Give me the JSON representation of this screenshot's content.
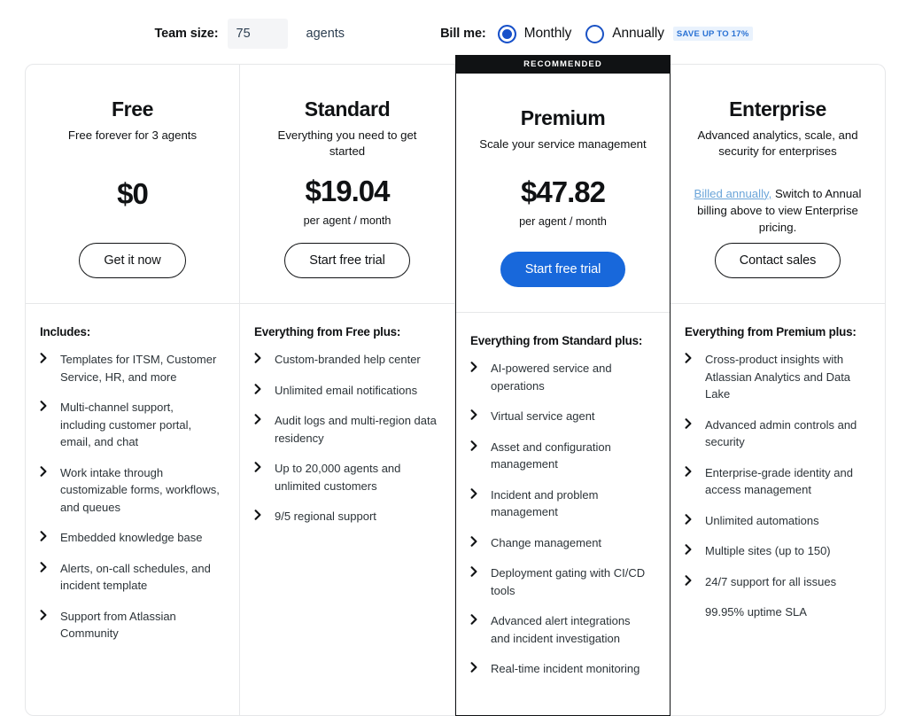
{
  "controls": {
    "team_size_label": "Team size:",
    "team_size_value": "75",
    "team_size_placeholder": "75",
    "agents_unit": "agents",
    "bill_me_label": "Bill me:",
    "billing_options": [
      {
        "label": "Monthly",
        "selected": true
      },
      {
        "label": "Annually",
        "selected": false
      }
    ],
    "monthly_label": "Monthly",
    "annually_label": "Annually",
    "save_badge": "SAVE UP TO 17%"
  },
  "colors": {
    "recommended_banner_bg": "#101214",
    "primary_cta_bg": "#1868db",
    "radio_selected": "#1750c9",
    "save_badge_text": "#2a72d4",
    "save_badge_bg": "#e9f2fd",
    "link_blue": "#6ba5d9",
    "border_grey": "#e6e7e9"
  },
  "plans": [
    {
      "name": "Free",
      "tagline": "Free forever for 3 agents",
      "price": "$0",
      "period": "",
      "cta": "Get it now",
      "cta_style": "outline",
      "recommended": false,
      "features_title": "Includes:",
      "features": [
        "Templates for ITSM, Customer Service, HR, and more",
        "Multi-channel support, including customer portal, email, and chat",
        "Work intake through customizable forms, workflows, and queues",
        "Embedded knowledge base",
        "Alerts, on-call schedules, and incident template",
        "Support from Atlassian Community"
      ]
    },
    {
      "name": "Standard",
      "tagline": "Everything you need to get started",
      "price": "$19.04",
      "period": "per agent / month",
      "cta": "Start free trial",
      "cta_style": "outline",
      "recommended": false,
      "features_title": "Everything from Free plus:",
      "features": [
        "Custom-branded help center",
        "Unlimited email notifications",
        "Audit logs and multi-region data residency",
        "Up to 20,000 agents and unlimited customers",
        "9/5 regional support"
      ]
    },
    {
      "name": "Premium",
      "tagline": "Scale your service management",
      "price": "$47.82",
      "period": "per agent / month",
      "cta": "Start free trial",
      "cta_style": "primary",
      "recommended": true,
      "recommended_badge": "RECOMMENDED",
      "features_title": "Everything from Standard plus:",
      "features": [
        "AI-powered service and operations",
        "Virtual service agent",
        "Asset and configuration management",
        "Incident and problem management",
        "Change management",
        "Deployment gating with CI/CD tools",
        "Advanced alert integrations and incident investigation",
        "Real-time incident monitoring"
      ]
    },
    {
      "name": "Enterprise",
      "tagline": "Advanced analytics, scale, and security for enterprises",
      "price": "",
      "period": "",
      "note_link": "Billed annually,",
      "note_rest": " Switch to Annual billing above to view Enterprise pricing.",
      "cta": "Contact sales",
      "cta_style": "outline",
      "recommended": false,
      "features_title": "Everything from Premium plus:",
      "features": [
        "Cross-product insights with Atlassian Analytics and Data Lake",
        "Advanced admin controls and security",
        "Enterprise-grade identity and access management",
        "Unlimited automations",
        "Multiple sites (up to 150)",
        "24/7 support for all issues"
      ],
      "footnote": "99.95% uptime SLA"
    }
  ]
}
